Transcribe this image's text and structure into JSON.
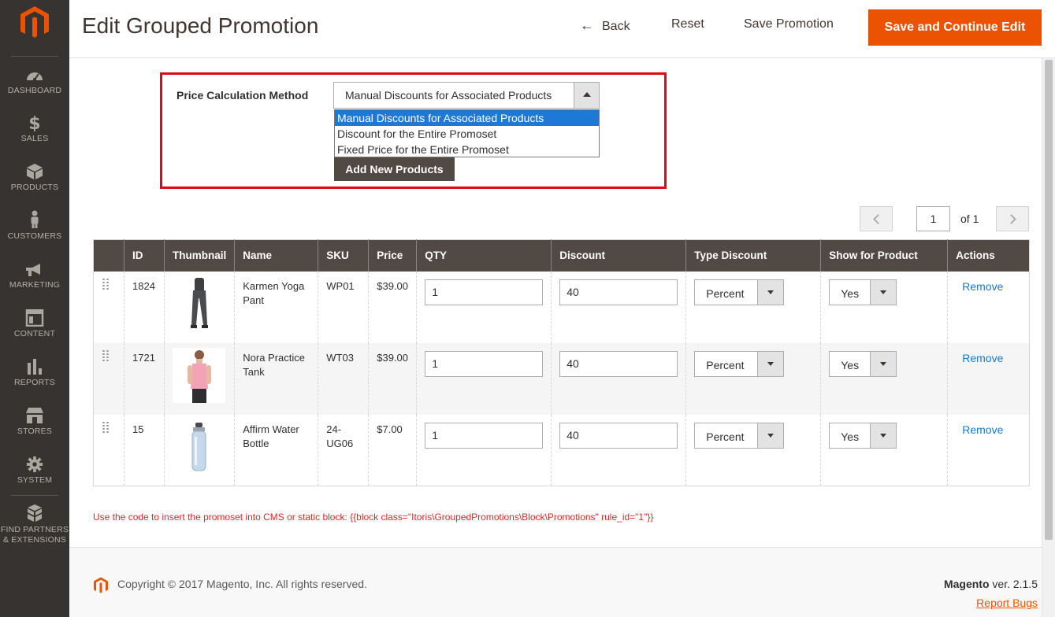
{
  "sidebar": {
    "items": [
      {
        "label": "DASHBOARD",
        "icon": "dashboard-icon"
      },
      {
        "label": "SALES",
        "icon": "dollar-icon"
      },
      {
        "label": "PRODUCTS",
        "icon": "cube-icon"
      },
      {
        "label": "CUSTOMERS",
        "icon": "person-icon"
      },
      {
        "label": "MARKETING",
        "icon": "megaphone-icon"
      },
      {
        "label": "CONTENT",
        "icon": "layout-icon"
      },
      {
        "label": "REPORTS",
        "icon": "bar-chart-icon"
      },
      {
        "label": "STORES",
        "icon": "store-icon"
      },
      {
        "label": "SYSTEM",
        "icon": "gear-icon"
      },
      {
        "label_line1": "FIND PARTNERS",
        "label_line2": "& EXTENSIONS",
        "icon": "blocks-icon"
      }
    ]
  },
  "header": {
    "title": "Edit Grouped Promotion",
    "back_label": "Back",
    "reset_label": "Reset",
    "save_label": "Save Promotion",
    "save_continue_label": "Save and Continue Edit"
  },
  "form": {
    "price_label": "Price Calculation Method",
    "price_value": "Manual Discounts for Associated Products",
    "options": [
      "Manual Discounts for Associated Products",
      "Discount for the Entire Promoset",
      "Fixed Price for the Entire Promoset"
    ],
    "add_button": "Add New Products"
  },
  "pager": {
    "page": "1",
    "of_label": "of 1"
  },
  "table": {
    "headers": [
      "",
      "ID",
      "Thumbnail",
      "Name",
      "SKU",
      "Price",
      "QTY",
      "Discount",
      "Type Discount",
      "Show for Product",
      "Actions"
    ],
    "rows": [
      {
        "id": "1824",
        "name": "Karmen Yoga Pant",
        "sku": "WP01",
        "price": "$39.00",
        "qty": "1",
        "discount": "40",
        "type": "Percent",
        "show": "Yes",
        "action": "Remove"
      },
      {
        "id": "1721",
        "name": "Nora Practice Tank",
        "sku": "WT03",
        "price": "$39.00",
        "qty": "1",
        "discount": "40",
        "type": "Percent",
        "show": "Yes",
        "action": "Remove"
      },
      {
        "id": "15",
        "name": "Affirm Water Bottle",
        "sku": "24-UG06",
        "price": "$7.00",
        "qty": "1",
        "discount": "40",
        "type": "Percent",
        "show": "Yes",
        "action": "Remove"
      }
    ]
  },
  "note": "Use the code to insert the promoset into CMS or static block: {{block class=\"Itoris\\GroupedPromotions\\Block\\Promotions\" rule_id=\"1\"}}",
  "footer": {
    "copyright": "Copyright © 2017 Magento, Inc. All rights reserved.",
    "brand": "Magento",
    "version": " ver. 2.1.5",
    "report_bugs": "Report Bugs"
  },
  "colors": {
    "accent": "#eb5202",
    "sidebar_bg": "#373330",
    "table_header_bg": "#514943",
    "highlight_border": "#e30613",
    "link": "#1979c3"
  }
}
